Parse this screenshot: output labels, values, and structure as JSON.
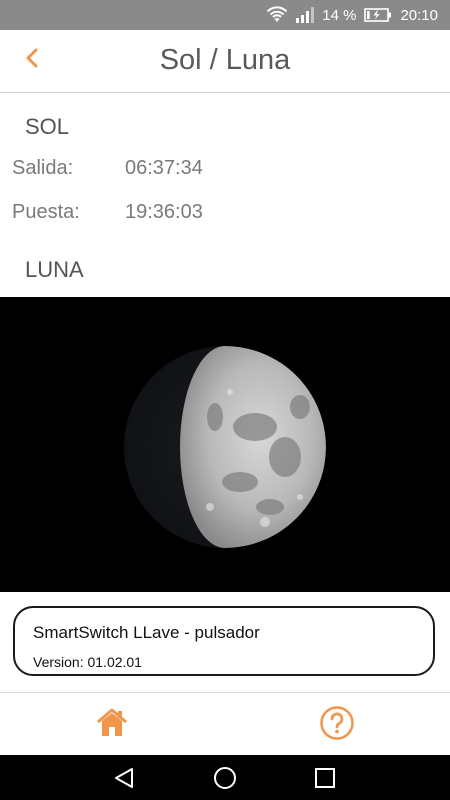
{
  "status_bar": {
    "battery_percent": "14 %",
    "time": "20:10",
    "battery_level": 0.14
  },
  "header": {
    "title": "Sol / Luna",
    "back_icon": "chevron-left-icon"
  },
  "sun": {
    "heading": "SOL",
    "rise_label": "Salida:",
    "rise_value": "06:37:34",
    "set_label": "Puesta:",
    "set_value": "19:36:03"
  },
  "moon": {
    "heading": "LUNA",
    "illumination_fraction": 0.6
  },
  "device_card": {
    "name": "SmartSwitch  LLave - pulsador",
    "version": "Version: 01.02.01"
  },
  "bottom_nav": {
    "accent_color": "#f0954a",
    "items": [
      {
        "icon": "home-icon"
      },
      {
        "icon": "help-icon"
      }
    ]
  },
  "system_nav": {
    "items": [
      {
        "icon": "back-triangle-icon"
      },
      {
        "icon": "home-circle-icon"
      },
      {
        "icon": "recents-square-icon"
      }
    ]
  }
}
